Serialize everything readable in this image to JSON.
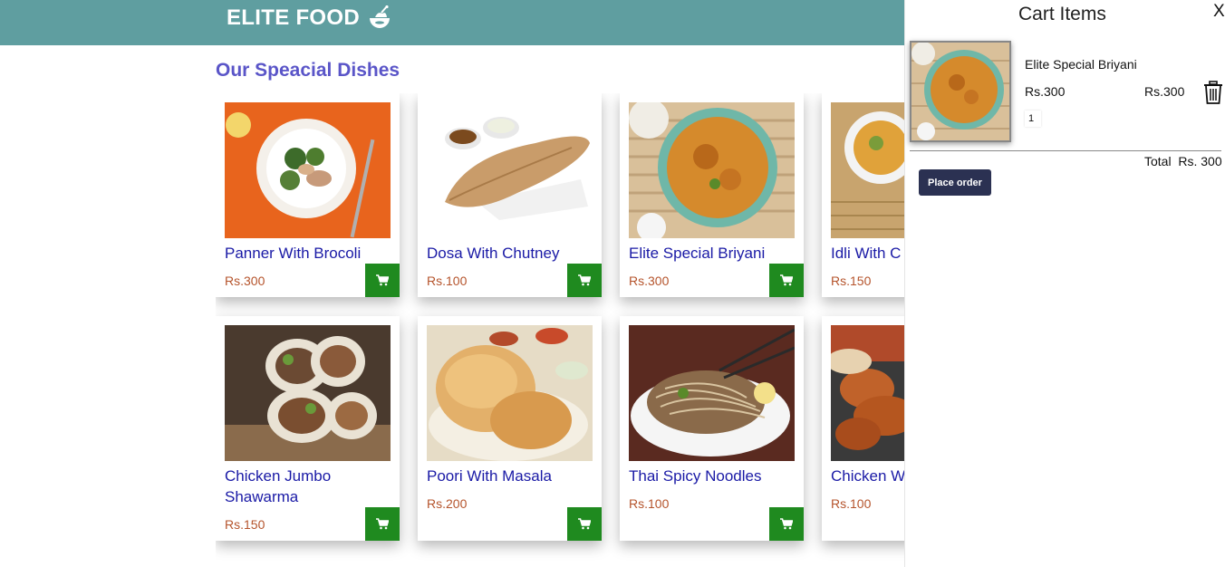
{
  "header": {
    "brand": "ELITE FOOD",
    "brand_icon": "food-bowl-icon",
    "bg_color": "#5f9ea0"
  },
  "section_title": "Our Speacial Dishes",
  "dishes": [
    {
      "name": "Panner With Brocoli",
      "price": "Rs.300"
    },
    {
      "name": "Dosa With Chutney",
      "price": "Rs.100"
    },
    {
      "name": "Elite Special Briyani",
      "price": "Rs.300"
    },
    {
      "name": "Idli With C",
      "price": "Rs.150"
    },
    {
      "name": "Chicken Jumbo Shawarma",
      "price": "Rs.150"
    },
    {
      "name": "Poori With Masala",
      "price": "Rs.200"
    },
    {
      "name": "Thai Spicy Noodles",
      "price": "Rs.100"
    },
    {
      "name": "Chicken W",
      "price": "Rs.100"
    }
  ],
  "cart": {
    "title": "Cart Items",
    "close_label": "X",
    "items": [
      {
        "name": "Elite Special Briyani",
        "price": "Rs.300",
        "subtotal": "Rs.300",
        "quantity": "1"
      }
    ],
    "total_label": "Total",
    "total_value": "Rs. 300",
    "place_order_label": "Place order"
  },
  "colors": {
    "accent_green": "#1f8a1f",
    "title_blue": "#5a55c8",
    "price_color": "#b5542c",
    "order_button": "#2b3152"
  }
}
